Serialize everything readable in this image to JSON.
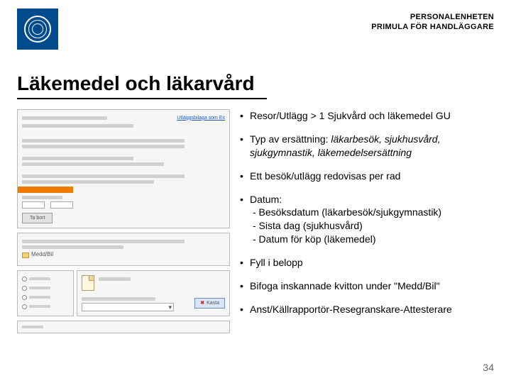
{
  "header": {
    "org_line1": "PERSONALENHETEN",
    "org_line2": "PRIMULA FÖR HANDLÄGGARE",
    "logo_alt": "Göteborgs universitet"
  },
  "title": "Läkemedel och läkarvård",
  "screenshot": {
    "top_link": "Utläggsbilaga som Ex",
    "button_new": "Ta bort",
    "meddbil_label": "Medd/Bil",
    "kasta_label": "Kasta"
  },
  "bullets": {
    "b1": "Resor/Utlägg > 1 Sjukvård och läkemedel GU",
    "b2_lead": "Typ av ersättning: ",
    "b2_em": "läkarbesök, sjukhusvård, sjukgymnastik, läkemedelsersättning",
    "b3": "Ett besök/utlägg redovisas per rad",
    "b4_lead": "Datum:",
    "b4_s1": "- Besöksdatum (läkarbesök/sjukgymnastik)",
    "b4_s2": "- Sista dag (sjukhusvård)",
    "b4_s3": "- Datum för köp (läkemedel)",
    "b5": "Fyll i belopp",
    "b6": "Bifoga inskannade kvitton under \"Medd/Bil\"",
    "b7": "Anst/Källrapportör-Resegranskare-Attesterare"
  },
  "page_number": "34"
}
